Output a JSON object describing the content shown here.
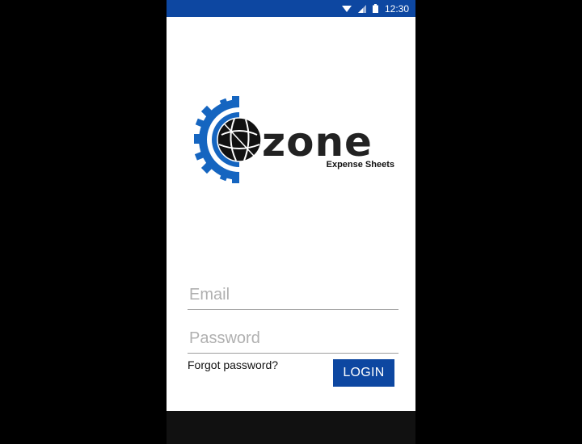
{
  "status_bar": {
    "time": "12:30",
    "icons": [
      "wifi-icon",
      "signal-icon",
      "battery-icon"
    ],
    "color": "#0d47a1"
  },
  "logo": {
    "wordmark": "zone",
    "tagline": "Expense Sheets",
    "gear_color": "#1565c0",
    "globe_color": "#111111"
  },
  "login_form": {
    "email_placeholder": "Email",
    "password_placeholder": "Password",
    "forgot_label": "Forgot password?",
    "login_label": "LOGIN",
    "accent": "#0d47a1"
  }
}
